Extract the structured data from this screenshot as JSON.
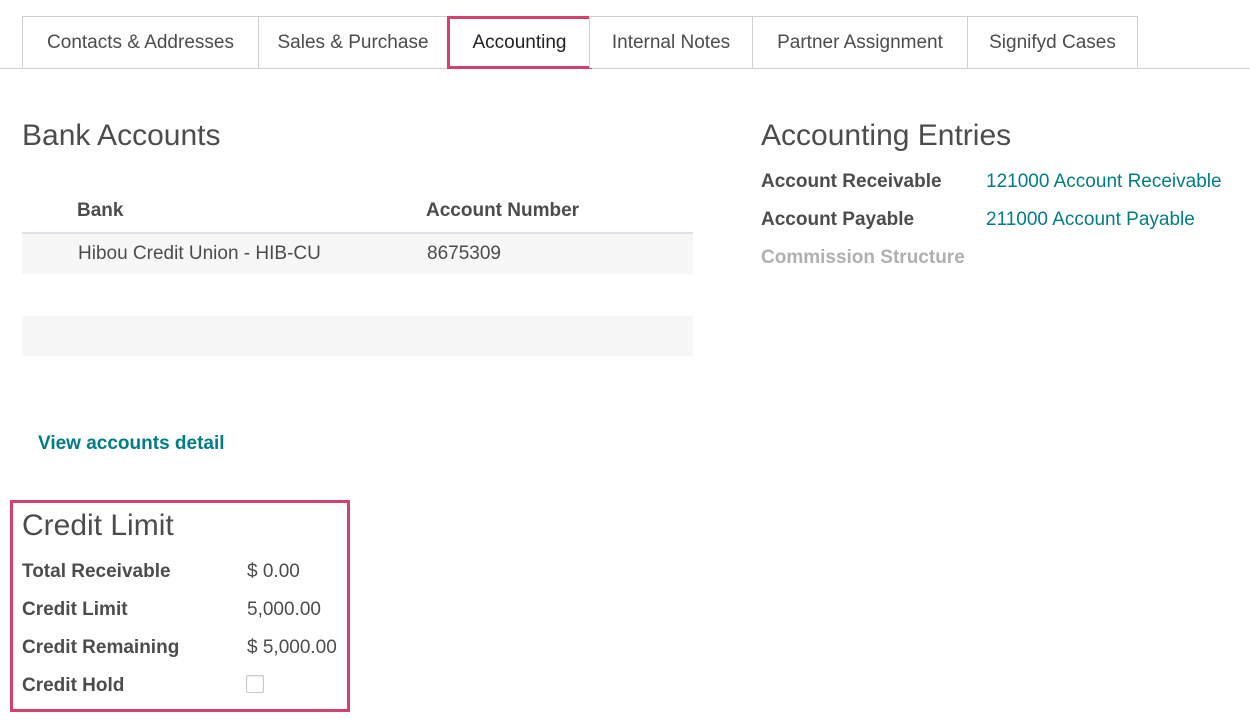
{
  "tabs": [
    {
      "label": "Contacts & Addresses",
      "active": false
    },
    {
      "label": "Sales & Purchase",
      "active": false
    },
    {
      "label": "Accounting",
      "active": true
    },
    {
      "label": "Internal Notes",
      "active": false
    },
    {
      "label": "Partner Assignment",
      "active": false
    },
    {
      "label": "Signifyd Cases",
      "active": false
    }
  ],
  "bank_accounts": {
    "title": "Bank Accounts",
    "columns": [
      "Bank",
      "Account Number"
    ],
    "rows": [
      {
        "bank": "Hibou Credit Union - HIB-CU",
        "account_number": "8675309"
      }
    ],
    "view_detail_link": "View accounts detail"
  },
  "accounting_entries": {
    "title": "Accounting Entries",
    "fields": [
      {
        "label": "Account Receivable",
        "value": "121000 Account Receivable"
      },
      {
        "label": "Account Payable",
        "value": "211000 Account Payable"
      },
      {
        "label": "Commission Structure",
        "value": ""
      }
    ]
  },
  "credit_limit": {
    "title": "Credit Limit",
    "fields": [
      {
        "label": "Total Receivable",
        "value": "$ 0.00"
      },
      {
        "label": "Credit Limit",
        "value": "5,000.00"
      },
      {
        "label": "Credit Remaining",
        "value": "$ 5,000.00"
      },
      {
        "label": "Credit Hold",
        "checked": false
      }
    ]
  },
  "colors": {
    "highlight": "#d5416b",
    "link": "#017e84",
    "text": "#4c4c4c",
    "muted_label": "#b0b0b0",
    "row_background": "#f7f7f7"
  }
}
